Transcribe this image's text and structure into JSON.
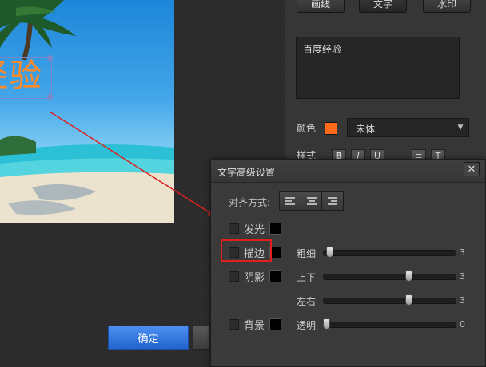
{
  "preview": {
    "overlay_text": "经验"
  },
  "right_panel": {
    "tabs": [
      "画线",
      "文字",
      "水印"
    ],
    "text_content": "百度经验",
    "color_label": "颜色",
    "color_value": "#ff6a1a",
    "font_value": "宋体",
    "style_label": "样式",
    "style_buttons": [
      "B",
      "I",
      "U"
    ]
  },
  "buttons": {
    "confirm": "确定"
  },
  "dialog": {
    "title": "文字高级设置",
    "close": "✕",
    "align_label": "对齐方式:",
    "options": [
      {
        "label": "发光",
        "checked": false,
        "color": "#000000"
      },
      {
        "label": "描边",
        "checked": false,
        "color": "#000000",
        "highlighted": true
      },
      {
        "label": "阴影",
        "checked": false,
        "color": "#000000"
      },
      {
        "label": "背景",
        "checked": false,
        "color": "#000000"
      }
    ],
    "sliders": [
      {
        "label": "粗细",
        "value": 3,
        "level": 0.04
      },
      {
        "label": "上下",
        "value": 3,
        "level": 0.64
      },
      {
        "label": "左右",
        "value": 3,
        "level": 0.64
      },
      {
        "label": "透明",
        "value": 0,
        "level": 0.02
      }
    ]
  }
}
